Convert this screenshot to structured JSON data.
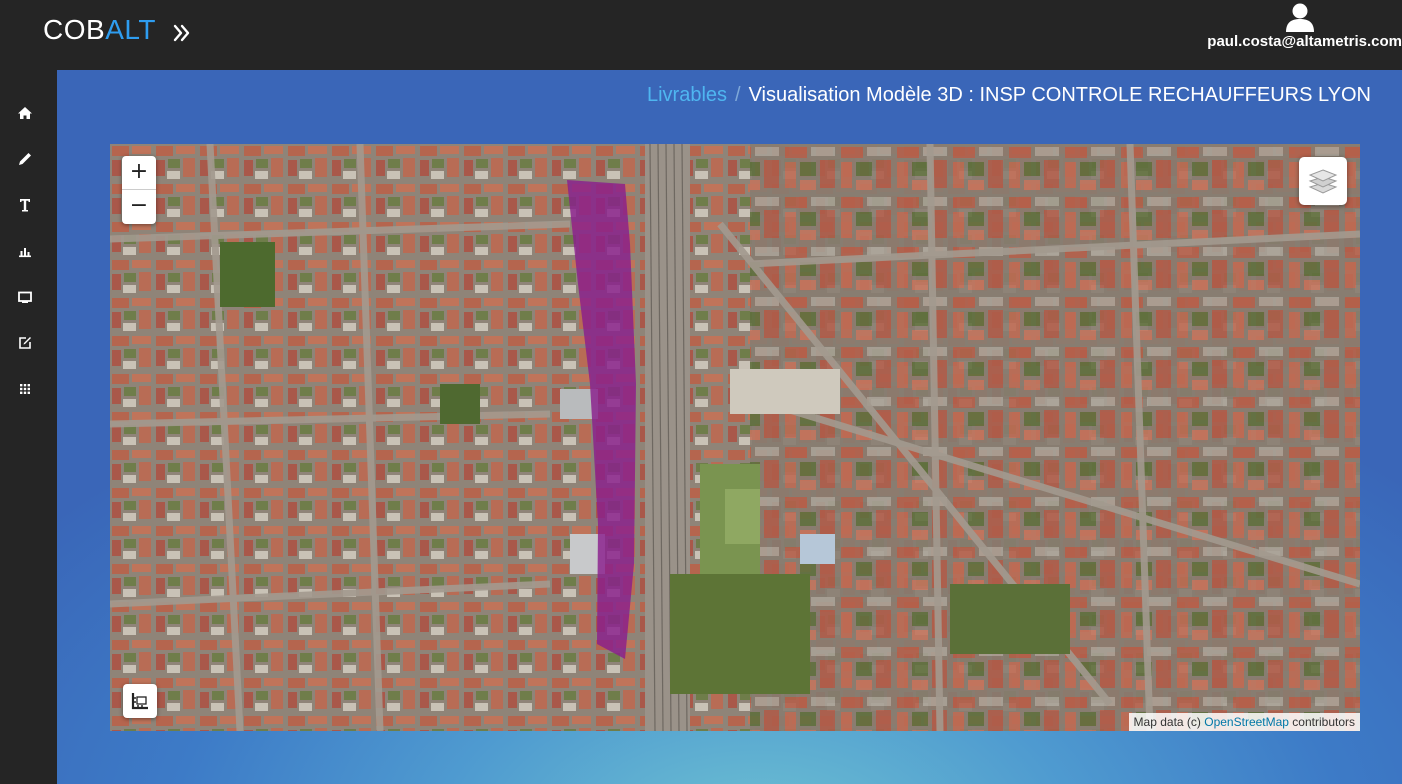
{
  "app": {
    "logo_part1": "COB",
    "logo_part2": "ALT",
    "logo_color_main": "#ffffff",
    "logo_color_accent": "#2e9df0",
    "expand_icon": "double-chevron-right-icon"
  },
  "user": {
    "icon": "user-icon",
    "email": "paul.costa@altametris.com"
  },
  "sidebar": {
    "items": [
      {
        "icon": "home-icon"
      },
      {
        "icon": "pencil-icon"
      },
      {
        "icon": "text-icon"
      },
      {
        "icon": "bar-chart-icon"
      },
      {
        "icon": "monitor-icon"
      },
      {
        "icon": "edit-icon"
      },
      {
        "icon": "grid-icon"
      }
    ]
  },
  "breadcrumb": {
    "link": "Livrables",
    "separator": "/",
    "current": "Visualisation Modèle 3D : INSP CONTROLE RECHAUFFEURS LYON"
  },
  "map": {
    "zoom_in": "+",
    "zoom_out": "−",
    "layers_icon": "layers-icon",
    "measure_icon": "measure-icon",
    "attribution_prefix": "Map data (c) ",
    "attribution_link": "OpenStreetMap",
    "attribution_suffix": " contributors",
    "overlay_color": "#8a1f8c"
  }
}
